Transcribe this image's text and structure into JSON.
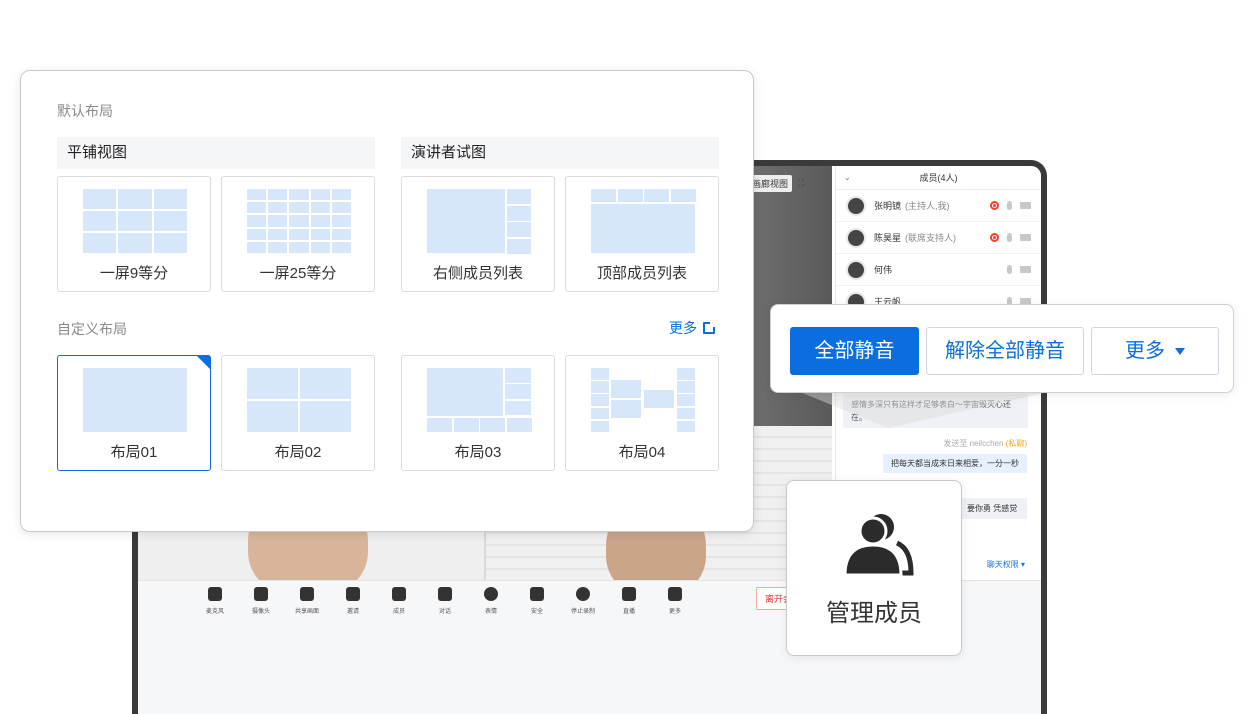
{
  "layout_panel": {
    "title": "默认布局",
    "tiled_group": "平铺视图",
    "speaker_group": "演讲者试图",
    "default_layouts": [
      {
        "label": "一屏9等分"
      },
      {
        "label": "一屏25等分"
      },
      {
        "label": "右侧成员列表"
      },
      {
        "label": "顶部成员列表"
      }
    ],
    "custom_title": "自定义布局",
    "more_label": "更多",
    "custom_layouts": [
      {
        "label": "布局01",
        "selected": true
      },
      {
        "label": "布局02",
        "selected": false
      },
      {
        "label": "布局03",
        "selected": false
      },
      {
        "label": "布局04",
        "selected": false
      }
    ]
  },
  "meeting": {
    "view_label": "画廊视图",
    "members_title": "成员(4人)",
    "members": [
      {
        "name": "张明镜",
        "role": "(主持人,我)",
        "recording": true
      },
      {
        "name": "陈昊星",
        "role": "(联席支持人)",
        "recording": true
      },
      {
        "name": "何伟",
        "role": "",
        "recording": false
      },
      {
        "name": "王云帆",
        "role": "",
        "recording": false
      }
    ],
    "chat": {
      "message_in": "感情多深只有这样才足够表白～宇宙毁灭心还在。",
      "sent_to_prefix": "发送至 neilcchen",
      "sent_to_private": "(私聊)",
      "message_out": "把每天都当成末日来相爱，一分一秒",
      "message_partial": "要你勇 凭感觉",
      "permission": "聊天权限 ▾"
    },
    "toolbar": [
      {
        "label": "麦克风",
        "icon": "microphone-icon"
      },
      {
        "label": "摄像头",
        "icon": "camera-icon"
      },
      {
        "label": "共享画面",
        "icon": "screen-share-icon"
      },
      {
        "label": "邀请",
        "icon": "invite-icon"
      },
      {
        "label": "成员",
        "icon": "members-icon"
      },
      {
        "label": "对话",
        "icon": "chat-icon"
      },
      {
        "label": "表情",
        "icon": "emoji-icon"
      },
      {
        "label": "安全",
        "icon": "security-icon"
      },
      {
        "label": "停止录制",
        "icon": "stop-record-icon"
      },
      {
        "label": "直播",
        "icon": "live-icon"
      },
      {
        "label": "更多",
        "icon": "more-icon"
      }
    ],
    "leave_label": "离开会"
  },
  "mute_popover": {
    "mute_all": "全部静音",
    "unmute_all": "解除全部静音",
    "more": "更多"
  },
  "manage_card": {
    "label": "管理成员",
    "icon": "manage-members-icon"
  },
  "colors": {
    "primary": "#0a6ee0",
    "thumb": "#d6e7fb",
    "danger": "#e03131"
  }
}
